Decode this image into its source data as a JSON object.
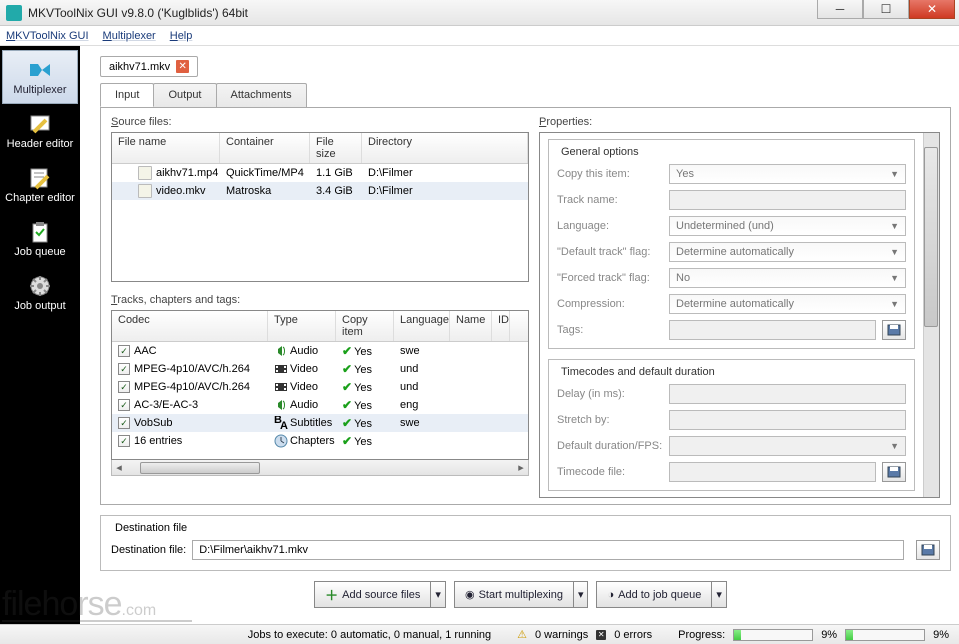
{
  "window": {
    "title": "MKVToolNix GUI v9.8.0 ('Kuglblids') 64bit"
  },
  "menubar": [
    "MKVToolNix GUI",
    "Multiplexer",
    "Help"
  ],
  "sidebar": [
    {
      "label": "Multiplexer",
      "selected": true
    },
    {
      "label": "Header editor",
      "selected": false
    },
    {
      "label": "Chapter editor",
      "selected": false
    },
    {
      "label": "Job queue",
      "selected": false
    },
    {
      "label": "Job output",
      "selected": false
    }
  ],
  "file_tabs": [
    {
      "name": "aikhv71.mkv"
    }
  ],
  "inner_tabs": [
    "Input",
    "Output",
    "Attachments"
  ],
  "inner_tab_selected": 0,
  "labels": {
    "source_files": "Source files:",
    "tracks": "Tracks, chapters and tags:",
    "properties": "Properties:",
    "dest_group": "Destination file",
    "dest_label": "Destination file:"
  },
  "source_files": {
    "columns": [
      "File name",
      "Container",
      "File size",
      "Directory"
    ],
    "rows": [
      {
        "name": "aikhv71.mp4",
        "container": "QuickTime/MP4",
        "size": "1.1 GiB",
        "dir": "D:\\Filmer"
      },
      {
        "name": "video.mkv",
        "container": "Matroska",
        "size": "3.4 GiB",
        "dir": "D:\\Filmer"
      }
    ]
  },
  "tracks": {
    "columns": [
      "Codec",
      "Type",
      "Copy item",
      "Language",
      "Name",
      "ID"
    ],
    "rows": [
      {
        "codec": "AAC",
        "type": "Audio",
        "type_icon": "audio",
        "copy": "Yes",
        "lang": "swe"
      },
      {
        "codec": "MPEG-4p10/AVC/h.264",
        "type": "Video",
        "type_icon": "video",
        "copy": "Yes",
        "lang": "und"
      },
      {
        "codec": "MPEG-4p10/AVC/h.264",
        "type": "Video",
        "type_icon": "video",
        "copy": "Yes",
        "lang": "und"
      },
      {
        "codec": "AC-3/E-AC-3",
        "type": "Audio",
        "type_icon": "audio",
        "copy": "Yes",
        "lang": "eng"
      },
      {
        "codec": "VobSub",
        "type": "Subtitles",
        "type_icon": "subs",
        "copy": "Yes",
        "lang": "swe",
        "sel": true
      },
      {
        "codec": "16 entries",
        "type": "Chapters",
        "type_icon": "chap",
        "copy": "Yes",
        "lang": ""
      }
    ]
  },
  "properties": {
    "general_title": "General options",
    "general": [
      {
        "label": "Copy this item:",
        "value": "Yes",
        "dropdown": true
      },
      {
        "label": "Track name:",
        "value": "",
        "dropdown": false
      },
      {
        "label": "Language:",
        "value": "Undetermined (und)",
        "dropdown": true
      },
      {
        "label": "\"Default track\" flag:",
        "value": "Determine automatically",
        "dropdown": true
      },
      {
        "label": "\"Forced track\" flag:",
        "value": "No",
        "dropdown": true
      },
      {
        "label": "Compression:",
        "value": "Determine automatically",
        "dropdown": true
      },
      {
        "label": "Tags:",
        "value": "",
        "dropdown": false,
        "browse": true
      }
    ],
    "timecodes_title": "Timecodes and default duration",
    "timecodes": [
      {
        "label": "Delay (in ms):",
        "value": "",
        "dropdown": false
      },
      {
        "label": "Stretch by:",
        "value": "",
        "dropdown": false
      },
      {
        "label": "Default duration/FPS:",
        "value": "",
        "dropdown": true
      },
      {
        "label": "Timecode file:",
        "value": "",
        "dropdown": false,
        "browse": true
      }
    ]
  },
  "destination": {
    "value": "D:\\Filmer\\aikhv71.mkv"
  },
  "buttons": {
    "add_source": "Add source files",
    "start_mux": "Start multiplexing",
    "add_queue": "Add to job queue"
  },
  "statusbar": {
    "jobs": "Jobs to execute:  0 automatic, 0 manual, 1 running",
    "warnings": "0 warnings",
    "errors": "0 errors",
    "progress_label": "Progress:",
    "pct1": "9%",
    "pct2": "9%",
    "progress1": 9,
    "progress2": 9
  },
  "watermark": {
    "brand": "filehorse",
    "suffix": ".com"
  }
}
